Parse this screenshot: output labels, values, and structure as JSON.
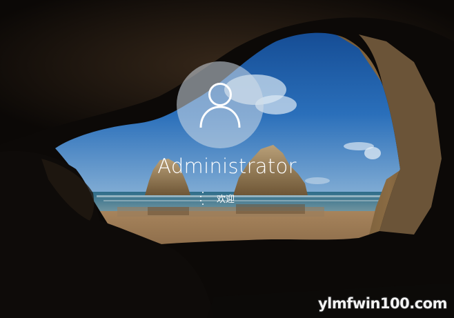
{
  "lock_screen": {
    "user": {
      "name": "Administrator",
      "avatar_icon": "user-silhouette-icon"
    },
    "status": {
      "text": "欢迎",
      "indicator_icon": "loading-spinner-icon"
    },
    "background": {
      "description_icon": "sea-cave-wallpaper",
      "sky_color": "#1a5aa8",
      "sea_color": "#3f7f9a",
      "sand_color": "#8a6a4a",
      "cave_color": "#0e0b08"
    }
  },
  "watermark": {
    "text": "ylmfwin100.com"
  }
}
